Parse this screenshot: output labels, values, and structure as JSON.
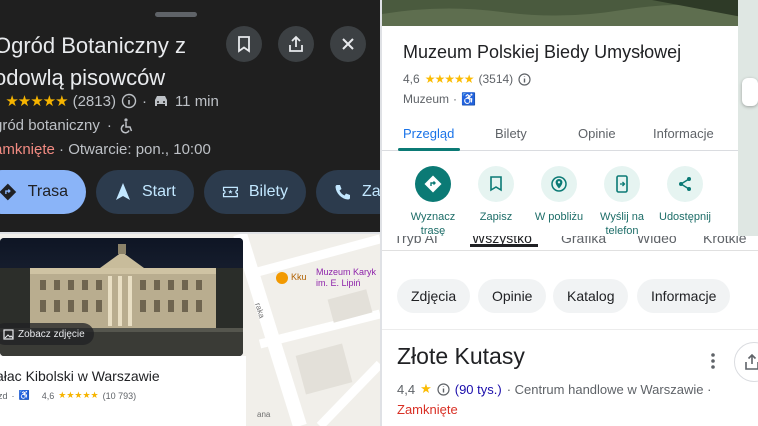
{
  "panel_dark": {
    "title_line1": "Ogród Botaniczny z",
    "title_line2": "odowlą pisowców",
    "rating": "5",
    "stars": "★★★★★",
    "review_count": "(2813)",
    "drive_time": "11 min",
    "category": "gród botaniczny",
    "status_closed": "amknięte",
    "status_open": " · Otwarcie: pon., 10:00",
    "btn_route": "Trasa",
    "btn_start": "Start",
    "btn_tickets": "Bilety",
    "btn_call": "Za"
  },
  "panel_map": {
    "photo_button": "Zobacz zdjęcie",
    "place_name": "ałac Kibolski w Warszawie",
    "small_rating": "4,6",
    "small_stars": "★★★★★",
    "small_count": "(10 793)",
    "small_cat": "zd",
    "map_label_1": "Muzeum Karyk",
    "map_label_2": "im. E. Lipiń",
    "map_label_3": "Kku",
    "street_1": "raka",
    "street_2": "ana"
  },
  "panel_museum": {
    "title": "Muzeum Polskiej Biedy Umysłowej",
    "rating": "4,6",
    "stars": "★★★★★",
    "review_count": "(3514)",
    "category": "Muzeum",
    "tabs": [
      "Przegląd",
      "Bilety",
      "Opinie",
      "Informacje"
    ],
    "actions": [
      "Wyznacz trasę",
      "Zapisz",
      "W pobliżu",
      "Wyślij na telefon",
      "Udostępnij"
    ]
  },
  "panel_search": {
    "top_tabs": [
      "Tryb AI",
      "Wszystko",
      "Grafika",
      "Wideo",
      "Krótkie"
    ],
    "chips": [
      "Zdjęcia",
      "Opinie",
      "Katalog",
      "Informacje"
    ],
    "result_title": "Złote Kutasy",
    "rating": "4,4",
    "reviews_link": "(90 tys.)",
    "category": "· Centrum handlowe w Warszawie ·",
    "status": "Zamknięte"
  },
  "colors": {
    "dark_bg": "#1f1f1f",
    "star": "#f6b400",
    "accent_blue": "#8ab4f8",
    "teal": "#0b7a75",
    "closed_red": "#d93025"
  }
}
